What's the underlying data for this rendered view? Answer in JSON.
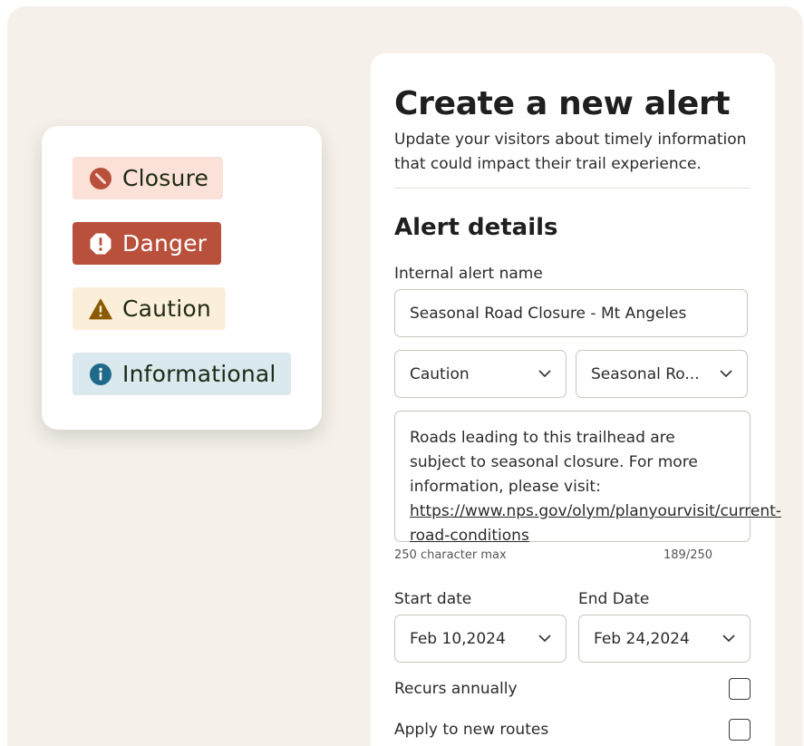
{
  "badges": [
    {
      "label": "Closure",
      "icon": "prohibited-icon",
      "color": "#b9503c"
    },
    {
      "label": "Danger",
      "icon": "exclamation-icon",
      "color": "#b9503c"
    },
    {
      "label": "Caution",
      "icon": "warning-icon",
      "color": "#8a5a00"
    },
    {
      "label": "Informational",
      "icon": "info-icon",
      "color": "#1f6a8a"
    }
  ],
  "form": {
    "title": "Create a new alert",
    "subtitle": "Update your visitors about timely information that could impact their trail experience.",
    "section_title": "Alert details",
    "alert_name_label": "Internal alert name",
    "alert_name_value": "Seasonal Road Closure - Mt Angeles",
    "type_select": "Caution",
    "category_select": "Seasonal Ro...",
    "message_text": "Roads leading to this trailhead are subject to seasonal closure. For more information, please visit: ",
    "message_link": "https://www.nps.gov/olym/planyourvisit/current-road-conditions",
    "char_max_hint": "250 character max",
    "char_count": "189/250",
    "start_date_label": "Start date",
    "start_date_value": "Feb 10,2024",
    "end_date_label": "End Date",
    "end_date_value": "Feb 24,2024",
    "recurs_label": "Recurs annually",
    "apply_routes_label": "Apply to new routes"
  }
}
